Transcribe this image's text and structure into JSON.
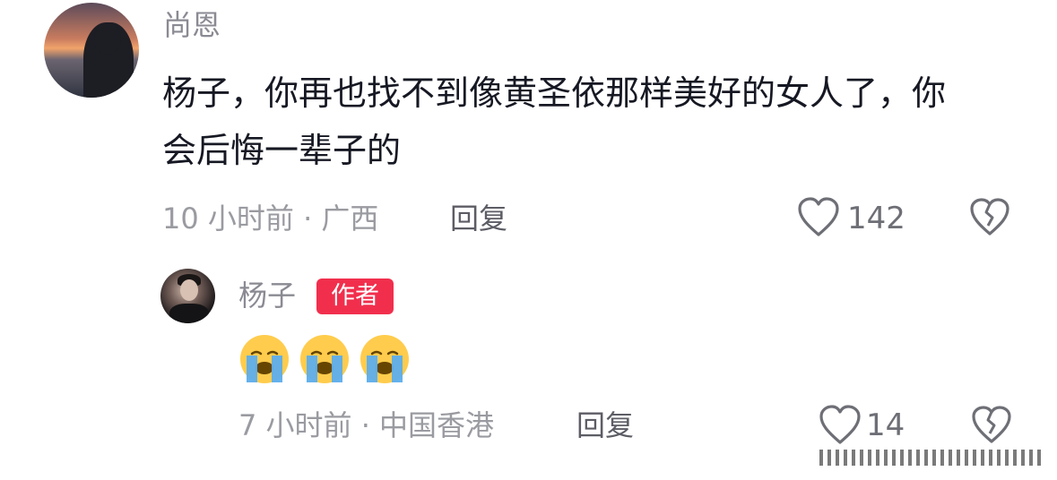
{
  "comment": {
    "username": "尚恩",
    "text": "杨子，你再也找不到像黄圣依那样美好的女人了，你会后悔一辈子的",
    "meta": "10 小时前 · 广西",
    "reply_label": "回复",
    "like_count": "142"
  },
  "reply": {
    "username": "杨子",
    "badge": "作者",
    "emojis": [
      "loudly-crying-face",
      "loudly-crying-face",
      "loudly-crying-face"
    ],
    "meta": "7 小时前 · 中国香港",
    "reply_label": "回复",
    "like_count": "14"
  }
}
